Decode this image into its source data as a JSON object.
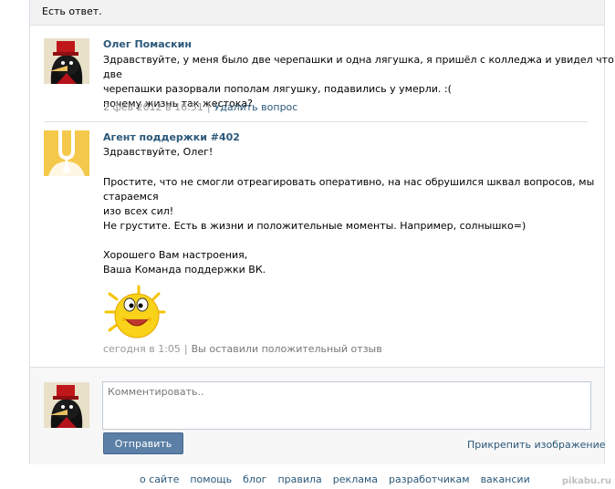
{
  "header": {
    "text": "Есть ответ."
  },
  "question": {
    "author": "Олег Помаскин",
    "lines": [
      "Здравствуйте, у меня было две черепашки и одна лягушка, я пришёл с колледжа и увидел что две",
      "черепашки разорвали пополам лягушку, подавились у умерли. :(",
      "почему жизнь так жестока?"
    ],
    "time": "2 фев 2012 в 16:51",
    "delete_label": "Удалить вопрос"
  },
  "answer": {
    "author": "Агент поддержки #402",
    "greeting": "Здравствуйте, Олег!",
    "para1_lines": [
      "Простите, что не смогли отреагировать оперативно, на нас обрушился шквал вопросов, мы стараемся",
      "изо всех сил!"
    ],
    "para2": "Не грустите. Есть в жизни и положительные моменты. Например, солнышко=)",
    "sign_lines": [
      "Хорошего Вам настроения,",
      "Ваша Команда поддержки ВК."
    ],
    "time": "сегодня в 1:05",
    "feedback": "Вы оставили положительный отзыв"
  },
  "comment": {
    "placeholder": "Комментировать..",
    "send_label": "Отправить",
    "attach_label": "Прикрепить изображение"
  },
  "footer": {
    "links": [
      "о сайте",
      "помощь",
      "блог",
      "правила",
      "реклама",
      "разработчикам",
      "вакансии"
    ]
  },
  "watermark": "pikabu.ru",
  "colors": {
    "link": "#2b587a",
    "button": "#5b7fa6",
    "meta": "#999999",
    "sun": "#f5c400"
  },
  "icons": {
    "avatar_user": "penguin-hat-avatar",
    "avatar_agent": "stethoscope-avatar",
    "emoji": "sun-smiley-icon"
  }
}
